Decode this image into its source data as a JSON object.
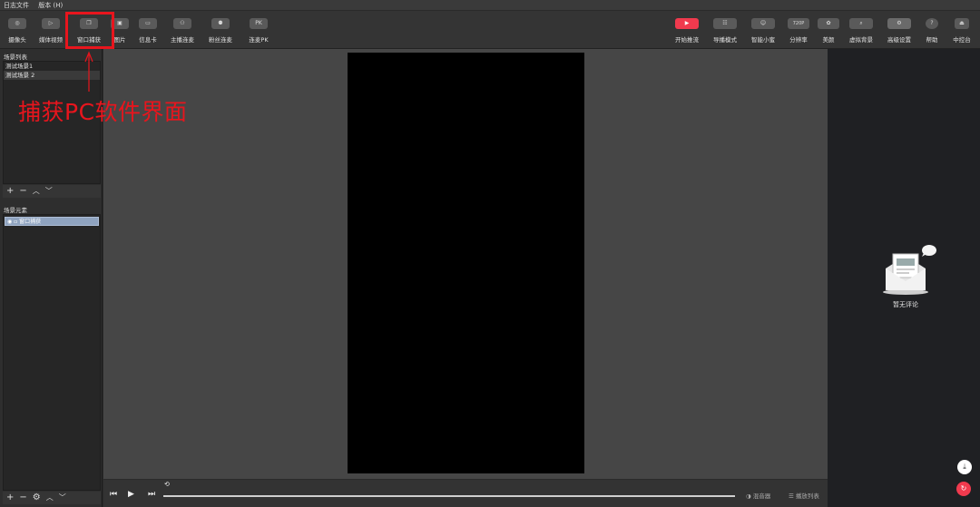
{
  "menubar": {
    "items": [
      "日志文件",
      "版本 (H)"
    ]
  },
  "toolbar": {
    "left": [
      {
        "label": "摄像头",
        "icon": "camera-icon",
        "glyph": "◎"
      },
      {
        "label": "媒体视频",
        "icon": "play-icon",
        "glyph": "▷"
      },
      {
        "label": "窗口捕获",
        "icon": "window-capture-icon",
        "glyph": "❐"
      },
      {
        "label": "图片",
        "icon": "image-icon",
        "glyph": "▣"
      },
      {
        "label": "信息卡",
        "icon": "info-card-icon",
        "glyph": "▭"
      },
      {
        "label": "主播连麦",
        "icon": "host-link-icon",
        "glyph": "⚇"
      },
      {
        "label": "粉丝连麦",
        "icon": "fan-link-icon",
        "glyph": "⚉"
      },
      {
        "label": "连麦PK",
        "icon": "pk-icon",
        "glyph": "PK"
      }
    ],
    "right": [
      {
        "label": "开始推流",
        "icon": "live-icon",
        "glyph": "▶"
      },
      {
        "label": "导播模式",
        "icon": "director-icon",
        "glyph": "☷"
      },
      {
        "label": "智能小蜜",
        "icon": "assistant-icon",
        "glyph": "☺"
      },
      {
        "label": "分辨率",
        "icon": "resolution-icon",
        "glyph": "720P"
      },
      {
        "label": "美颜",
        "icon": "beauty-icon",
        "glyph": "✿"
      },
      {
        "label": "虚拟背景",
        "icon": "virtual-bg-icon",
        "glyph": "⌕"
      },
      {
        "label": "高级设置",
        "icon": "settings-icon",
        "glyph": "⚙"
      },
      {
        "label": "帮助",
        "icon": "help-icon",
        "glyph": "?"
      },
      {
        "label": "中控台",
        "icon": "console-icon",
        "glyph": "⏏"
      }
    ]
  },
  "annotation": {
    "text": "捕获PC软件界面",
    "color": "#e8151d"
  },
  "scenes": {
    "title": "场景列表",
    "items": [
      "测试场景1",
      "测试场景 2"
    ]
  },
  "elements": {
    "title": "场景元素",
    "items": [
      "窗口捕获"
    ]
  },
  "playbar": {
    "mixer": "混音器",
    "playlist": "播放列表"
  },
  "comments": {
    "empty": "暂无评论"
  },
  "colors": {
    "accent": "#f03a4e",
    "highlight": "#e8151d"
  }
}
